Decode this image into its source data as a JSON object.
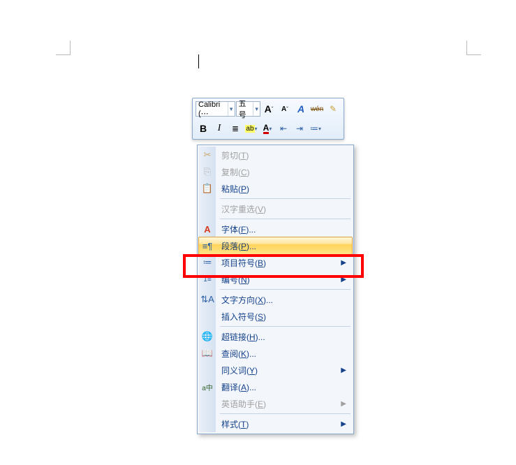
{
  "toolbar": {
    "font_name": "Calibri (⋯",
    "font_size": "五号",
    "buttons_row1": {
      "grow_font": "A",
      "shrink_font": "A",
      "text_effects": "A",
      "char_shading": "wén",
      "format_painter": "✎"
    },
    "buttons_row2": {
      "bold": "B",
      "italic": "I",
      "center": "≣",
      "highlight": "ab",
      "font_color": "A",
      "decrease_indent": "⇤",
      "increase_indent": "⇥",
      "bullets": "≔"
    }
  },
  "menu": {
    "cut": "剪切(T)",
    "copy": "复制(C)",
    "paste": "粘贴(P)",
    "reconvert": "汉字重选(V)",
    "font": "字体(F)...",
    "paragraph": "段落(P)...",
    "bullets": "项目符号(B)",
    "numbering": "编号(N)",
    "text_dir": "文字方向(X)...",
    "symbol": "插入符号(S)",
    "hyperlink": "超链接(H)...",
    "lookup": "查阅(K)...",
    "synonyms": "同义词(Y)",
    "translate": "翻译(A)...",
    "eng_assist": "英语助手(E)",
    "styles": "样式(T)"
  },
  "arrow": "▶",
  "dd": "▾"
}
